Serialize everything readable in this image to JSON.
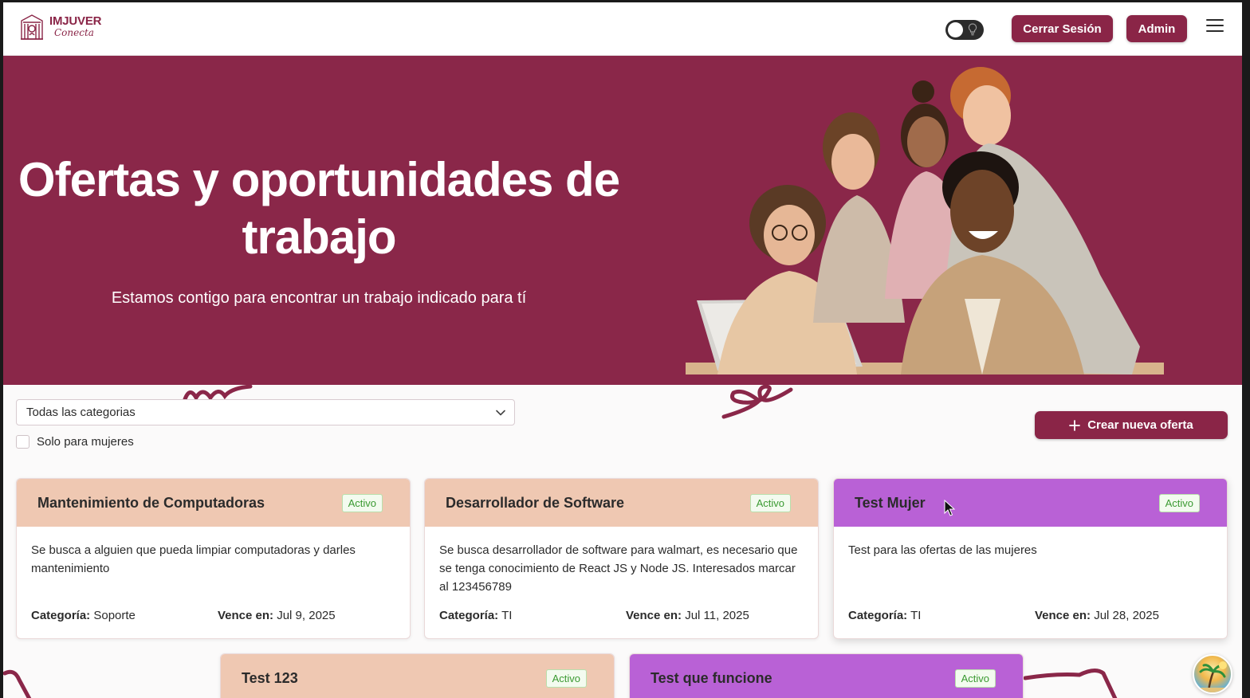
{
  "header": {
    "logo_title": "IMJUVER",
    "logo_subtitle": "Conecta",
    "logout_label": "Cerrar Sesión",
    "admin_label": "Admin"
  },
  "hero": {
    "title": "Ofertas y oportunidades de trabajo",
    "subtitle": "Estamos contigo para encontrar un trabajo indicado para tí"
  },
  "filters": {
    "category_selected": "Todas las categorias",
    "women_only_label": "Solo para mujeres",
    "women_only_checked": false
  },
  "create_button_label": "Crear nueva oferta",
  "labels": {
    "category": "Categoría:",
    "expires": "Vence en:"
  },
  "colors": {
    "brand": "#8a2547",
    "card_peach": "#efc8b2",
    "card_purple": "#b961d6",
    "active_green": "#3b9a32"
  },
  "cards": [
    {
      "title": "Mantenimiento de Computadoras",
      "status": "Activo",
      "description": "Se busca a alguien que pueda limpiar computadoras y darles mantenimiento",
      "category": "Soporte",
      "expires": "Jul 9, 2025",
      "women_only": false
    },
    {
      "title": "Desarrollador de Software",
      "status": "Activo",
      "description": "Se busca desarrollador de software para walmart, es necesario que se tenga conocimiento de React JS y Node JS. Interesados marcar al 123456789",
      "category": "TI",
      "expires": "Jul 11, 2025",
      "women_only": false
    },
    {
      "title": "Test Mujer",
      "status": "Activo",
      "description": "Test para las ofertas de las mujeres",
      "category": "TI",
      "expires": "Jul 28, 2025",
      "women_only": true
    },
    {
      "title": "Test 123",
      "status": "Activo",
      "women_only": false
    },
    {
      "title": "Test que funcione",
      "status": "Activo",
      "women_only": true
    }
  ]
}
